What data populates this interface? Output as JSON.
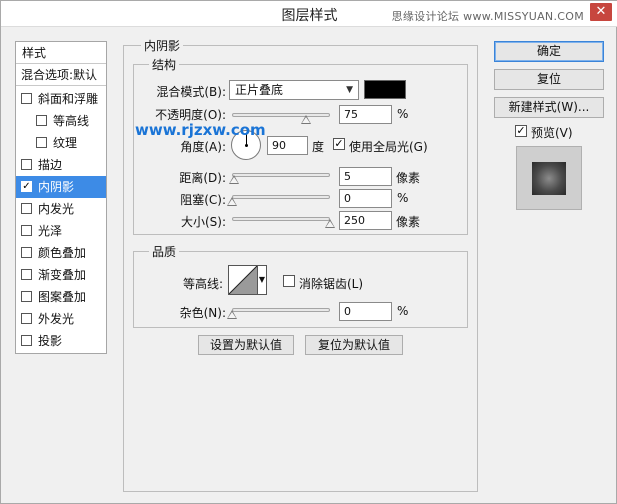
{
  "window": {
    "title": "图层样式",
    "watermark": "思缘设计论坛 www.MISSYUAN.COM",
    "close_glyph": "✕"
  },
  "style_list": {
    "header": "样式",
    "blend_options": "混合选项:默认",
    "items": [
      {
        "label": "斜面和浮雕",
        "checked": false
      },
      {
        "label": "等高线",
        "checked": false
      },
      {
        "label": "纹理",
        "checked": false
      },
      {
        "label": "描边",
        "checked": false
      },
      {
        "label": "内阴影",
        "checked": true
      },
      {
        "label": "内发光",
        "checked": false
      },
      {
        "label": "光泽",
        "checked": false
      },
      {
        "label": "颜色叠加",
        "checked": false
      },
      {
        "label": "渐变叠加",
        "checked": false
      },
      {
        "label": "图案叠加",
        "checked": false
      },
      {
        "label": "外发光",
        "checked": false
      },
      {
        "label": "投影",
        "checked": false
      }
    ]
  },
  "inner_shadow": {
    "group_title": "内阴影",
    "structure_title": "结构",
    "blend_mode_label": "混合模式(B):",
    "blend_mode_value": "正片叠底",
    "shadow_color": "#000000",
    "opacity_label": "不透明度(O):",
    "opacity_value": "75",
    "opacity_unit": "%",
    "angle_label": "角度(A):",
    "angle_value": "90",
    "angle_unit": "度",
    "global_light_label": "使用全局光(G)",
    "global_light_checked": true,
    "distance_label": "距离(D):",
    "distance_value": "5",
    "distance_unit": "像素",
    "choke_label": "阻塞(C):",
    "choke_value": "0",
    "choke_unit": "%",
    "size_label": "大小(S):",
    "size_value": "250",
    "size_unit": "像素",
    "quality_title": "品质",
    "contour_label": "等高线:",
    "anti_alias_label": "消除锯齿(L)",
    "anti_alias_checked": false,
    "noise_label": "杂色(N):",
    "noise_value": "0",
    "noise_unit": "%",
    "make_default": "设置为默认值",
    "reset_default": "复位为默认值"
  },
  "sliders": {
    "opacity_fraction": 0.75,
    "distance_fraction": 0.02,
    "choke_fraction": 0.0,
    "size_fraction": 1.0,
    "noise_fraction": 0.0
  },
  "actions": {
    "ok": "确定",
    "reset": "复位",
    "new_style": "新建样式(W)...",
    "preview_label": "预览(V)",
    "preview_checked": true
  },
  "site_watermark": "www.rjzxw.com",
  "check_glyph": "✓",
  "arrow_glyph": "▼"
}
